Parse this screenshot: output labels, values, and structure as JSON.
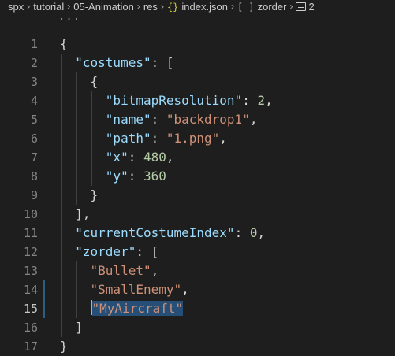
{
  "breadcrumb": {
    "items": [
      {
        "label": "spx",
        "icon": ""
      },
      {
        "label": "tutorial",
        "icon": ""
      },
      {
        "label": "05-Animation",
        "icon": ""
      },
      {
        "label": "res",
        "icon": ""
      },
      {
        "label": "index.json",
        "icon": "json-braces-icon",
        "glyph": "{}"
      },
      {
        "label": "zorder",
        "icon": "array-brackets-icon",
        "glyph": "[ ]"
      },
      {
        "label": "2",
        "icon": "number-icon",
        "glyph": ""
      }
    ],
    "separator": "›"
  },
  "editor": {
    "folded_indicator": "···",
    "lines": [
      {
        "number": "1",
        "tokens": [
          {
            "t": "punc",
            "v": "{"
          }
        ]
      },
      {
        "number": "2",
        "tokens": [
          {
            "t": "punc",
            "v": "  "
          },
          {
            "t": "key",
            "v": "\"costumes\""
          },
          {
            "t": "punc",
            "v": ": ["
          }
        ]
      },
      {
        "number": "3",
        "tokens": [
          {
            "t": "punc",
            "v": "    {"
          }
        ]
      },
      {
        "number": "4",
        "tokens": [
          {
            "t": "punc",
            "v": "      "
          },
          {
            "t": "key",
            "v": "\"bitmapResolution\""
          },
          {
            "t": "punc",
            "v": ": "
          },
          {
            "t": "num",
            "v": "2"
          },
          {
            "t": "punc",
            "v": ","
          }
        ]
      },
      {
        "number": "5",
        "tokens": [
          {
            "t": "punc",
            "v": "      "
          },
          {
            "t": "key",
            "v": "\"name\""
          },
          {
            "t": "punc",
            "v": ": "
          },
          {
            "t": "str",
            "v": "\"backdrop1\""
          },
          {
            "t": "punc",
            "v": ","
          }
        ]
      },
      {
        "number": "6",
        "tokens": [
          {
            "t": "punc",
            "v": "      "
          },
          {
            "t": "key",
            "v": "\"path\""
          },
          {
            "t": "punc",
            "v": ": "
          },
          {
            "t": "str",
            "v": "\"1.png\""
          },
          {
            "t": "punc",
            "v": ","
          }
        ]
      },
      {
        "number": "7",
        "tokens": [
          {
            "t": "punc",
            "v": "      "
          },
          {
            "t": "key",
            "v": "\"x\""
          },
          {
            "t": "punc",
            "v": ": "
          },
          {
            "t": "num",
            "v": "480"
          },
          {
            "t": "punc",
            "v": ","
          }
        ]
      },
      {
        "number": "8",
        "tokens": [
          {
            "t": "punc",
            "v": "      "
          },
          {
            "t": "key",
            "v": "\"y\""
          },
          {
            "t": "punc",
            "v": ": "
          },
          {
            "t": "num",
            "v": "360"
          }
        ]
      },
      {
        "number": "9",
        "tokens": [
          {
            "t": "punc",
            "v": "    }"
          }
        ]
      },
      {
        "number": "10",
        "tokens": [
          {
            "t": "punc",
            "v": "  ],"
          }
        ]
      },
      {
        "number": "11",
        "tokens": [
          {
            "t": "punc",
            "v": "  "
          },
          {
            "t": "key",
            "v": "\"currentCostumeIndex\""
          },
          {
            "t": "punc",
            "v": ": "
          },
          {
            "t": "num",
            "v": "0"
          },
          {
            "t": "punc",
            "v": ","
          }
        ]
      },
      {
        "number": "12",
        "tokens": [
          {
            "t": "punc",
            "v": "  "
          },
          {
            "t": "key",
            "v": "\"zorder\""
          },
          {
            "t": "punc",
            "v": ": ["
          }
        ]
      },
      {
        "number": "13",
        "tokens": [
          {
            "t": "punc",
            "v": "    "
          },
          {
            "t": "str",
            "v": "\"Bullet\""
          },
          {
            "t": "punc",
            "v": ","
          }
        ]
      },
      {
        "number": "14",
        "tokens": [
          {
            "t": "punc",
            "v": "    "
          },
          {
            "t": "str",
            "v": "\"SmallEnemy\""
          },
          {
            "t": "punc",
            "v": ","
          }
        ],
        "modified": true
      },
      {
        "number": "15",
        "tokens": [
          {
            "t": "punc",
            "v": "    "
          },
          {
            "t": "cursor",
            "v": ""
          },
          {
            "t": "str sel",
            "v": "\"MyAircraft\""
          }
        ],
        "modified": true,
        "active": true
      },
      {
        "number": "16",
        "tokens": [
          {
            "t": "punc",
            "v": "  ]"
          }
        ]
      },
      {
        "number": "17",
        "tokens": [
          {
            "t": "punc",
            "v": "}"
          }
        ]
      }
    ]
  },
  "colors": {
    "background": "#1e1e1e",
    "key": "#9cdcfe",
    "string": "#ce9178",
    "number": "#b5cea8",
    "selection": "#264f78",
    "modified_gutter": "#2d5e7e"
  }
}
